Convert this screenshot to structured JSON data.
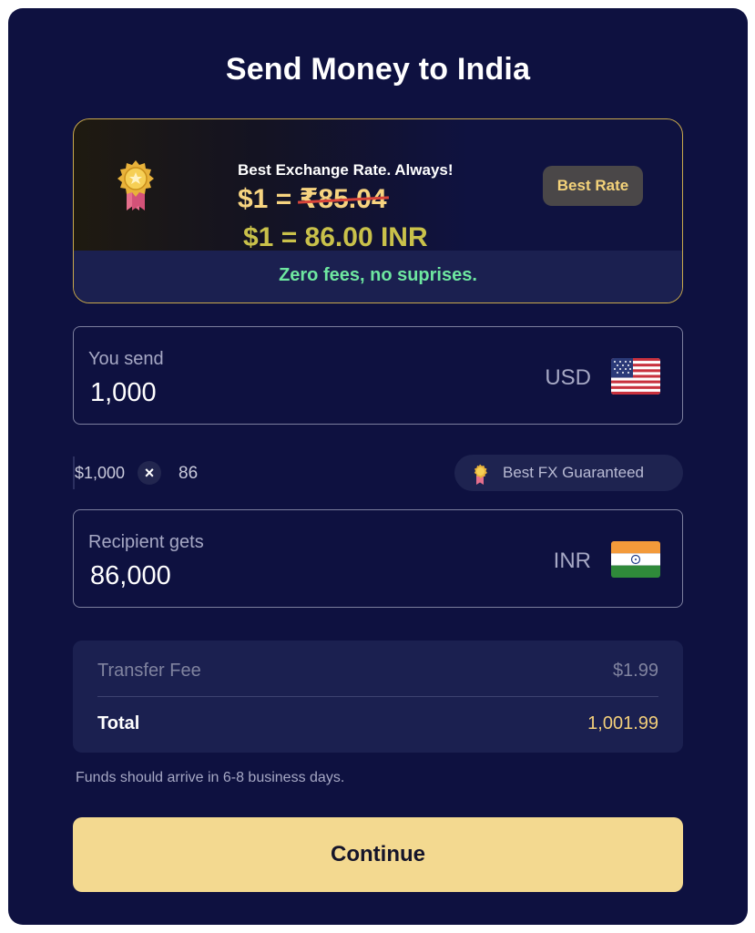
{
  "page": {
    "title": "Send Money to India"
  },
  "promo": {
    "heading": "Best Exchange Rate. Always!",
    "old_rate_prefix": "$1 = ",
    "old_rate_struck": "₹85.04",
    "new_rate": "$1 = 86.00 INR",
    "badge": "Best Rate",
    "note": "Zero fees, no suprises."
  },
  "send": {
    "label": "You send",
    "value": "1,000",
    "currency": "USD",
    "flag_icon": "us-flag-icon"
  },
  "calc": {
    "amount": "$1,000",
    "operator": "×",
    "rate": "86",
    "guarantee": "Best FX Guaranteed"
  },
  "receive": {
    "label": "Recipient gets",
    "value": "86,000",
    "currency": "INR",
    "flag_icon": "india-flag-icon"
  },
  "summary": {
    "fee_label": "Transfer Fee",
    "fee_value": "$1.99",
    "total_label": "Total",
    "total_value": "1,001.99"
  },
  "arrival_note": "Funds should arrive in 6-8 business days.",
  "continue_label": "Continue",
  "colors": {
    "background": "#0e1140",
    "accent_gold": "#f3d990",
    "success_green": "#6ee7a0",
    "strike_red": "#d9453a"
  }
}
